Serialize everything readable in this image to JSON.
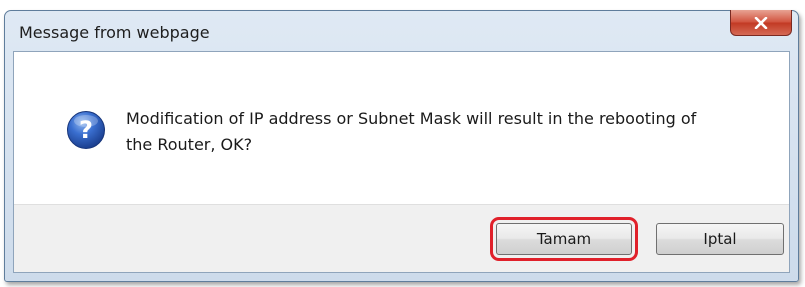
{
  "dialog": {
    "title": "Message from webpage",
    "message_line1": "Modification of IP address or Subnet Mask will result in the rebooting of",
    "message_line2": "the Router, OK?",
    "buttons": {
      "ok_label": "Tamam",
      "cancel_label": "Iptal"
    },
    "icons": {
      "close": "close-icon",
      "question": "question-icon"
    },
    "colors": {
      "highlight": "#e0202a",
      "close_button": "#c94a34",
      "question_icon": "#2a5bb8"
    }
  }
}
